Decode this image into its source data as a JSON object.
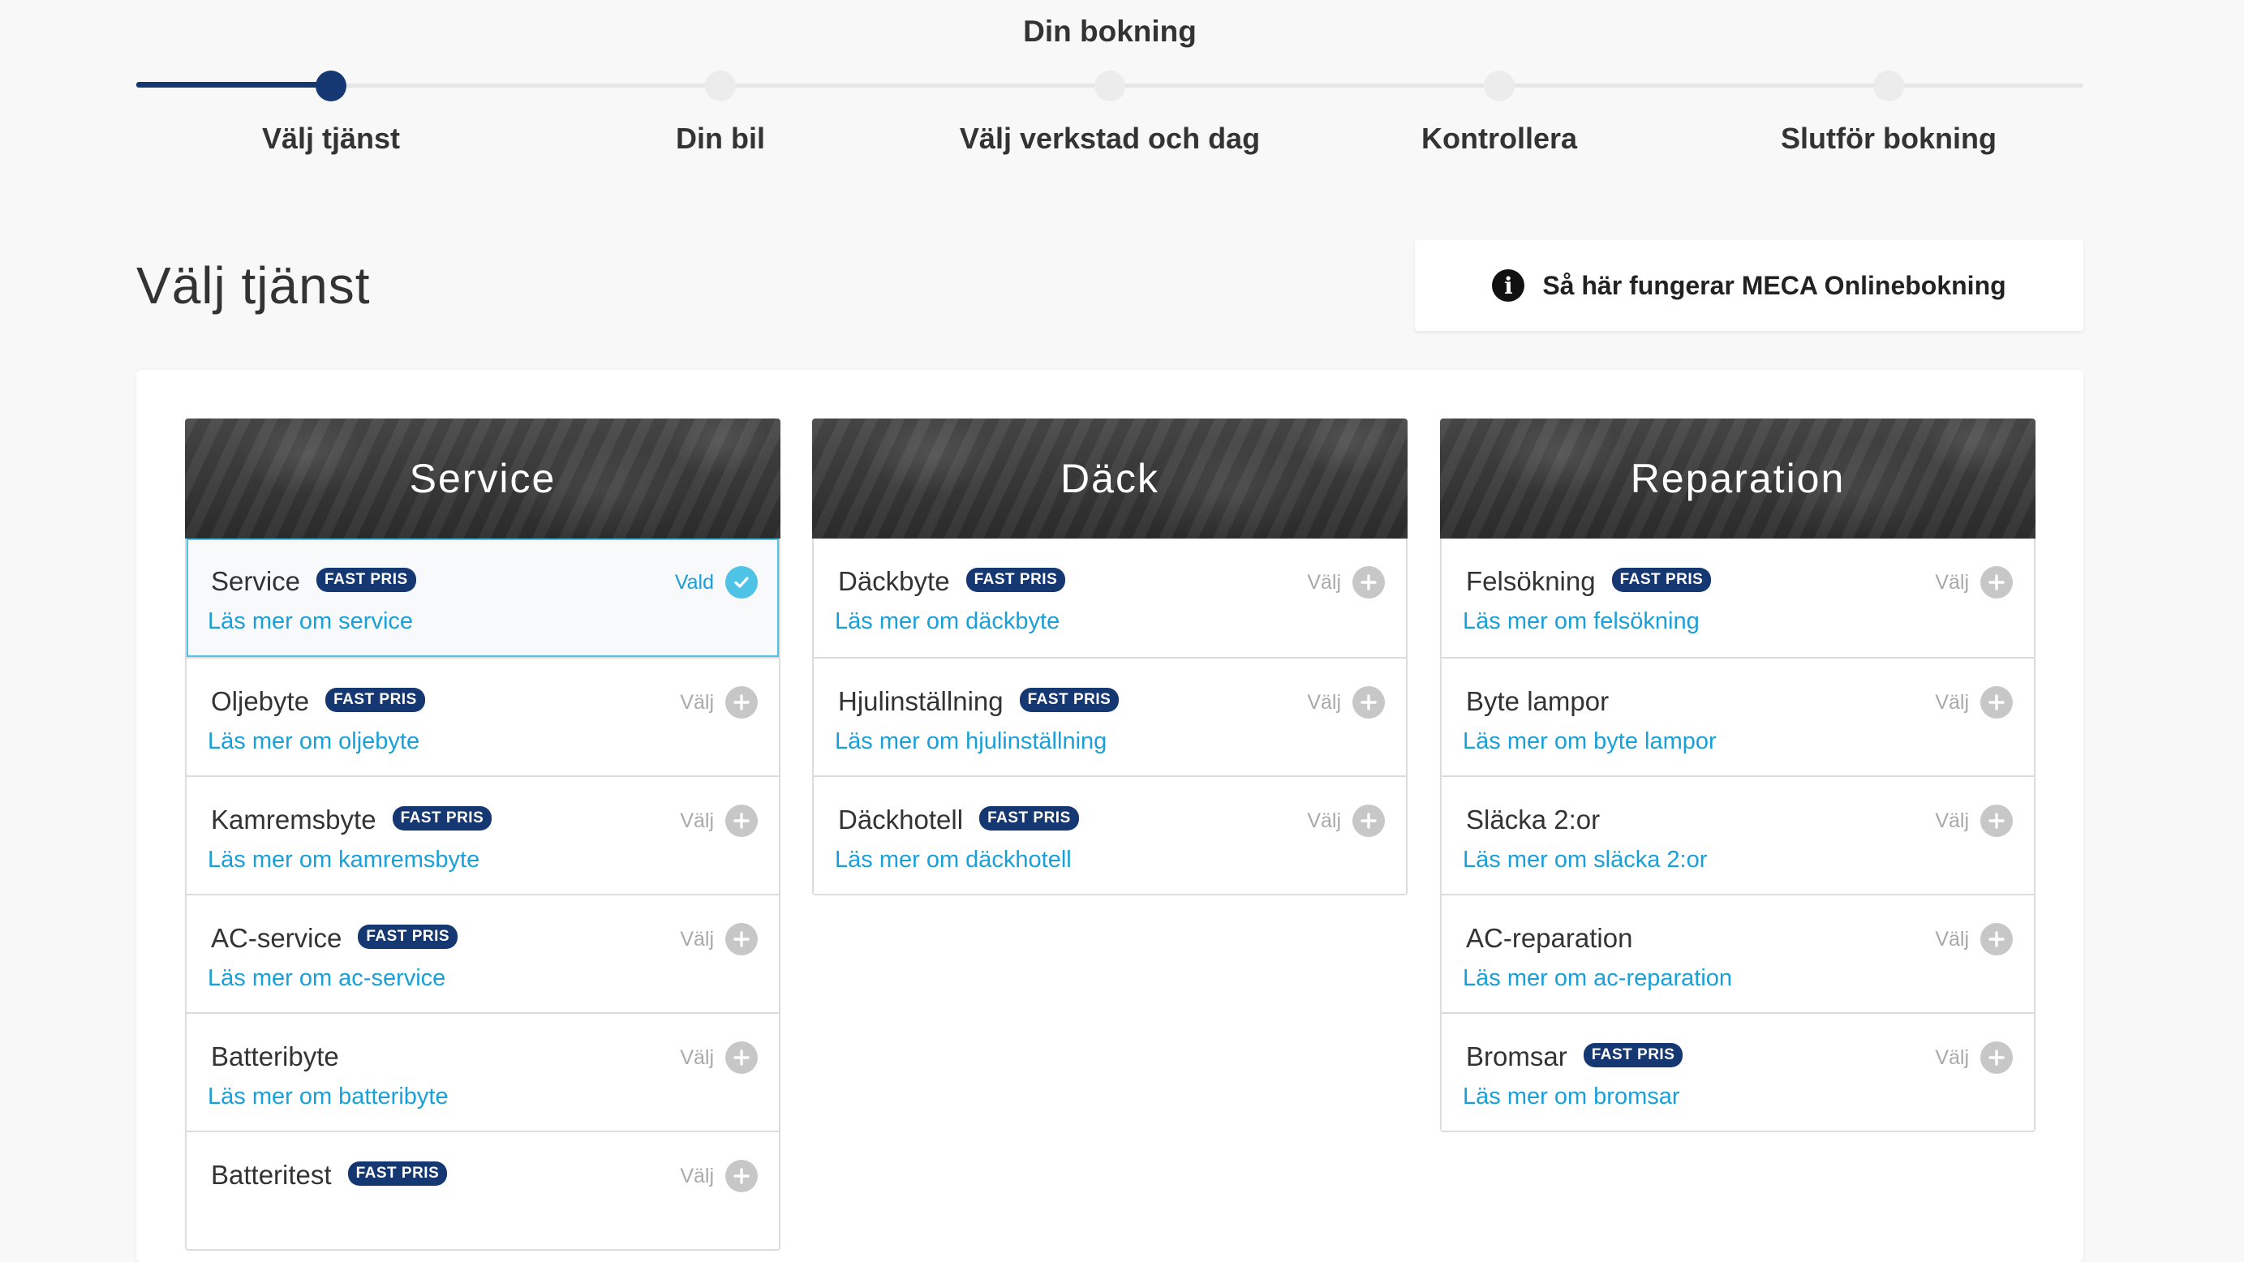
{
  "booking_title": "Din bokning",
  "steps": [
    {
      "label": "Välj tjänst",
      "active": true
    },
    {
      "label": "Din bil",
      "active": false
    },
    {
      "label": "Välj verkstad och dag",
      "active": false
    },
    {
      "label": "Kontrollera",
      "active": false
    },
    {
      "label": "Slutför bokning",
      "active": false
    }
  ],
  "page_title": "Välj tjänst",
  "info_button": {
    "label": "Så här fungerar MECA Onlinebokning",
    "icon": "info-icon"
  },
  "badge_label": "FAST PRIS",
  "colors": {
    "primary": "#163872",
    "link": "#1aa0d8",
    "selected": "#4fc3e6"
  },
  "columns": [
    {
      "title": "Service",
      "items": [
        {
          "name": "Service",
          "badge": true,
          "link": "Läs mer om service",
          "action": "Vald",
          "selected": true
        },
        {
          "name": "Oljebyte",
          "badge": true,
          "link": "Läs mer om oljebyte",
          "action": "Välj",
          "selected": false
        },
        {
          "name": "Kamremsbyte",
          "badge": true,
          "link": "Läs mer om kamremsbyte",
          "action": "Välj",
          "selected": false
        },
        {
          "name": "AC-service",
          "badge": true,
          "link": "Läs mer om ac-service",
          "action": "Välj",
          "selected": false
        },
        {
          "name": "Batteribyte",
          "badge": false,
          "link": "Läs mer om batteribyte",
          "action": "Välj",
          "selected": false
        },
        {
          "name": "Batteritest",
          "badge": true,
          "link": "",
          "action": "Välj",
          "selected": false
        }
      ]
    },
    {
      "title": "Däck",
      "items": [
        {
          "name": "Däckbyte",
          "badge": true,
          "link": "Läs mer om däckbyte",
          "action": "Välj",
          "selected": false
        },
        {
          "name": "Hjulinställning",
          "badge": true,
          "link": "Läs mer om hjulinställning",
          "action": "Välj",
          "selected": false
        },
        {
          "name": "Däckhotell",
          "badge": true,
          "link": "Läs mer om däckhotell",
          "action": "Välj",
          "selected": false
        }
      ]
    },
    {
      "title": "Reparation",
      "items": [
        {
          "name": "Felsökning",
          "badge": true,
          "link": "Läs mer om felsökning",
          "action": "Välj",
          "selected": false
        },
        {
          "name": "Byte lampor",
          "badge": false,
          "link": "Läs mer om byte lampor",
          "action": "Välj",
          "selected": false
        },
        {
          "name": "Släcka 2:or",
          "badge": false,
          "link": "Läs mer om släcka 2:or",
          "action": "Välj",
          "selected": false
        },
        {
          "name": "AC-reparation",
          "badge": false,
          "link": "Läs mer om ac-reparation",
          "action": "Välj",
          "selected": false
        },
        {
          "name": "Bromsar",
          "badge": true,
          "link": "Läs mer om bromsar",
          "action": "Välj",
          "selected": false
        }
      ]
    }
  ]
}
